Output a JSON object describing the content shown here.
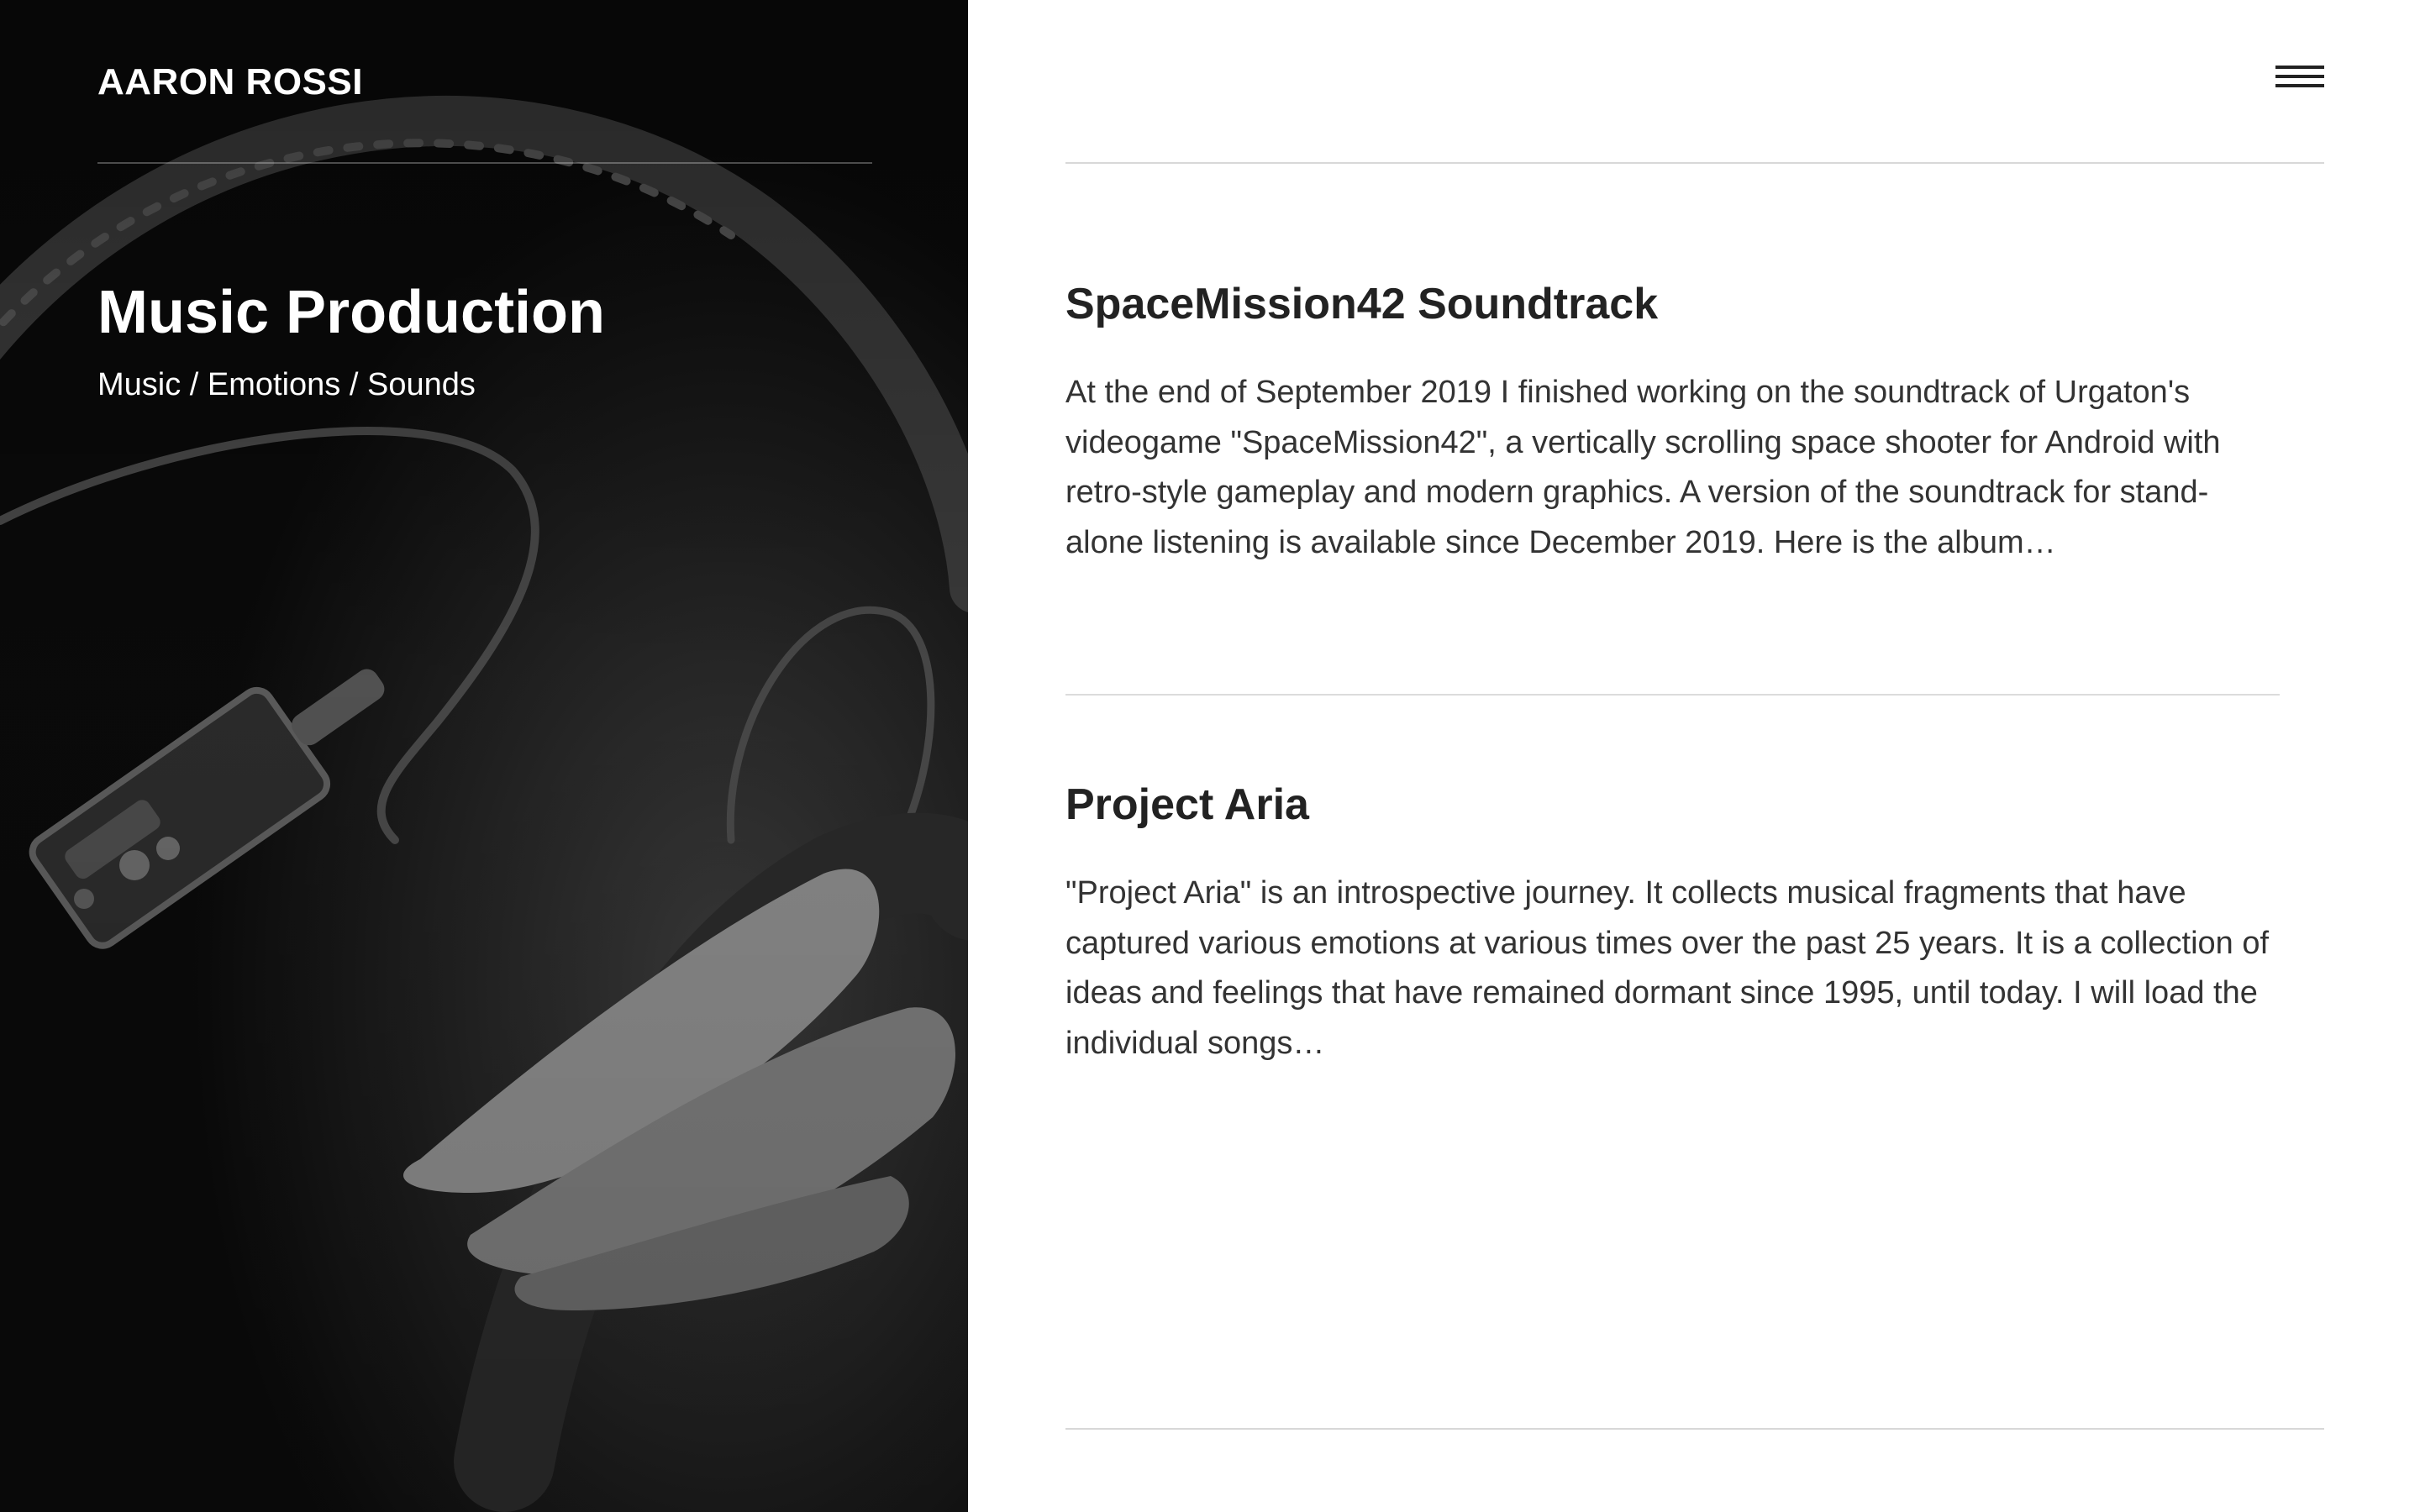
{
  "header": {
    "site_title": "AARON ROSSI",
    "menu_icon": "hamburger-menu-icon"
  },
  "hero": {
    "title": "Music Production",
    "subtitle": "Music / Emotions / Sounds",
    "image_icon": "headphones-and-cables-image"
  },
  "posts": [
    {
      "title": "SpaceMission42 Soundtrack",
      "excerpt": "At the end of September 2019 I finished working on the soundtrack of Urgaton's videogame \"SpaceMission42\", a vertically scrolling space shooter for Android with retro-style gameplay and modern graphics. A version of the soundtrack for stand-alone listening is available since December 2019. Here is the album…"
    },
    {
      "title": "Project Aria",
      "excerpt": "\"Project Aria\" is an introspective journey. It collects musical fragments that have captured various emotions at various times over the past 25 years. It is a collection of ideas and feelings that have remained dormant since 1995, until today. I will load the individual songs…"
    }
  ],
  "colors": {
    "hero_background": "#0b0b0b",
    "text_primary": "#222222",
    "text_body": "#333333",
    "rule": "#d8d8d8"
  }
}
